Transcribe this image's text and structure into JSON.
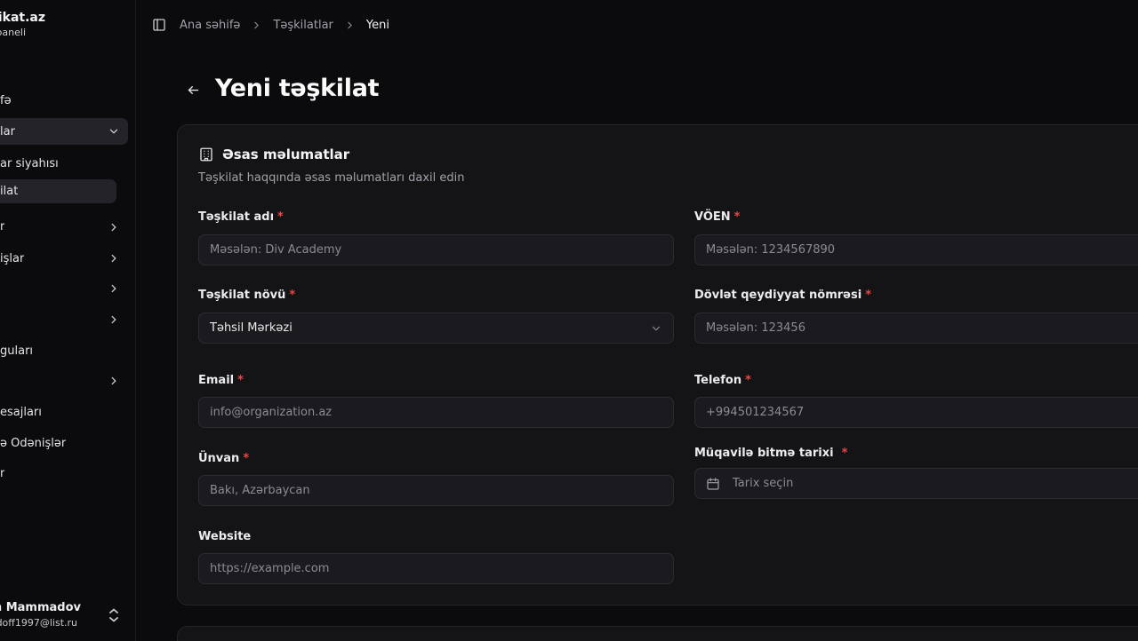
{
  "app": {
    "title": "tifikat.az",
    "subtitle": "paneli"
  },
  "sidebar": {
    "items": [
      {
        "label": "fə",
        "has_chevron": false
      },
      {
        "label": "lar",
        "has_chevron": true,
        "expanded": true
      },
      {
        "label": "ar siyahısı",
        "sub": true
      },
      {
        "label": "ilat",
        "sub": true,
        "active": true
      },
      {
        "label": "r",
        "has_chevron": true
      },
      {
        "label": "işlar",
        "has_chevron": true
      },
      {
        "label": "",
        "has_chevron": true
      },
      {
        "label": "",
        "has_chevron": true
      },
      {
        "label": "guları",
        "has_chevron": false
      },
      {
        "label": "",
        "has_chevron": true
      },
      {
        "label": "esajları",
        "has_chevron": false
      },
      {
        "label": "ə Ödənişlər",
        "has_chevron": false
      },
      {
        "label": "r",
        "has_chevron": false
      }
    ]
  },
  "user": {
    "name": "m Mammadov",
    "email": "doff1997@list.ru"
  },
  "breadcrumb": {
    "home": "Ana səhifə",
    "section": "Təşkilatlar",
    "current": "Yeni"
  },
  "page": {
    "title": "Yeni təşkilat"
  },
  "card": {
    "title": "Əsas məlumatlar",
    "description": "Təşkilat haqqında əsas məlumatları daxil edin"
  },
  "form": {
    "org_name": {
      "label": "Təşkilat adı",
      "required": "*",
      "placeholder": "Məsələn: Div Academy"
    },
    "voen": {
      "label": "VÖEN",
      "required": "*",
      "placeholder": "Məsələn: 1234567890"
    },
    "org_type": {
      "label": "Təşkilat növü",
      "required": "*",
      "value": "Təhsil Mərkəzi"
    },
    "reg_number": {
      "label": "Dövlət qeydiyyat nömrəsi",
      "required": "*",
      "placeholder": "Məsələn: 123456"
    },
    "email": {
      "label": "Email",
      "required": "*",
      "placeholder": "info@organization.az"
    },
    "phone": {
      "label": "Telefon",
      "required": "*",
      "placeholder": "+994501234567"
    },
    "address": {
      "label": "Ünvan",
      "required": "*",
      "placeholder": "Bakı, Azərbaycan"
    },
    "contract_end": {
      "label": "Müqavilə bitmə tarixi",
      "required": "*",
      "placeholder": "Tarix seçin"
    },
    "website": {
      "label": "Website",
      "placeholder": "https://example.com"
    }
  },
  "colors": {
    "background": "#0b0b0d",
    "card": "#141417",
    "input": "#1b1b1f",
    "required": "#ef4444",
    "active_nav": "#232329"
  }
}
